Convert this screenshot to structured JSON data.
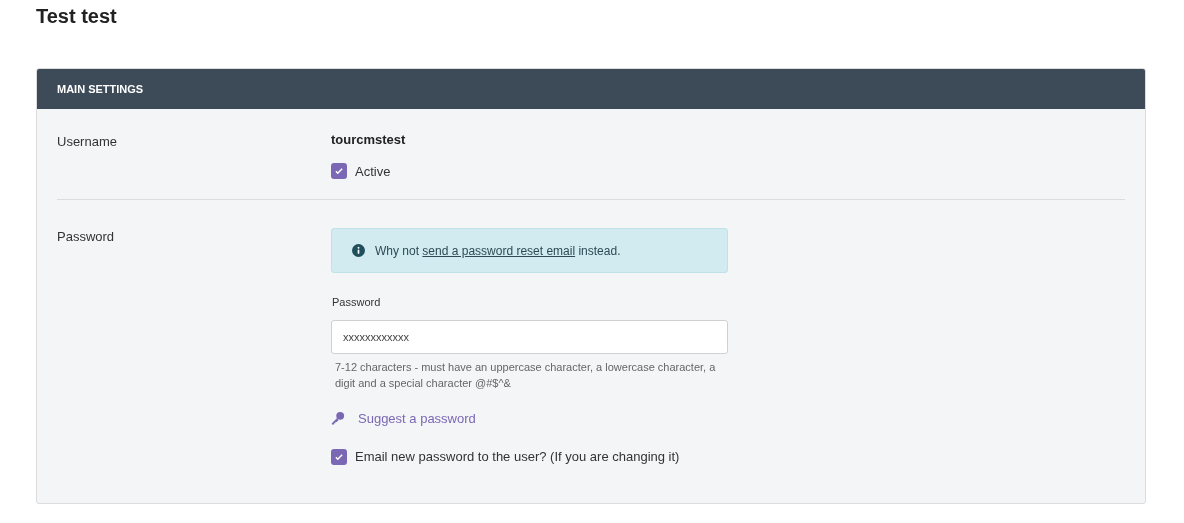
{
  "page_title": "Test test",
  "panel": {
    "title": "MAIN SETTINGS",
    "username": {
      "label": "Username",
      "value": "tourcmstest",
      "active": {
        "label": "Active",
        "checked": true
      }
    },
    "password": {
      "label": "Password",
      "alert": {
        "before": "Why not ",
        "link": "send a password reset email",
        "after": " instead."
      },
      "field": {
        "label": "Password",
        "value": "xxxxxxxxxxxx",
        "help": "7-12 characters - must have an uppercase character, a lowercase character, a digit and a special character @#$^&"
      },
      "suggest": "Suggest a password",
      "email": {
        "label": "Email new password to the user? (If you are changing it)",
        "checked": true
      }
    }
  }
}
